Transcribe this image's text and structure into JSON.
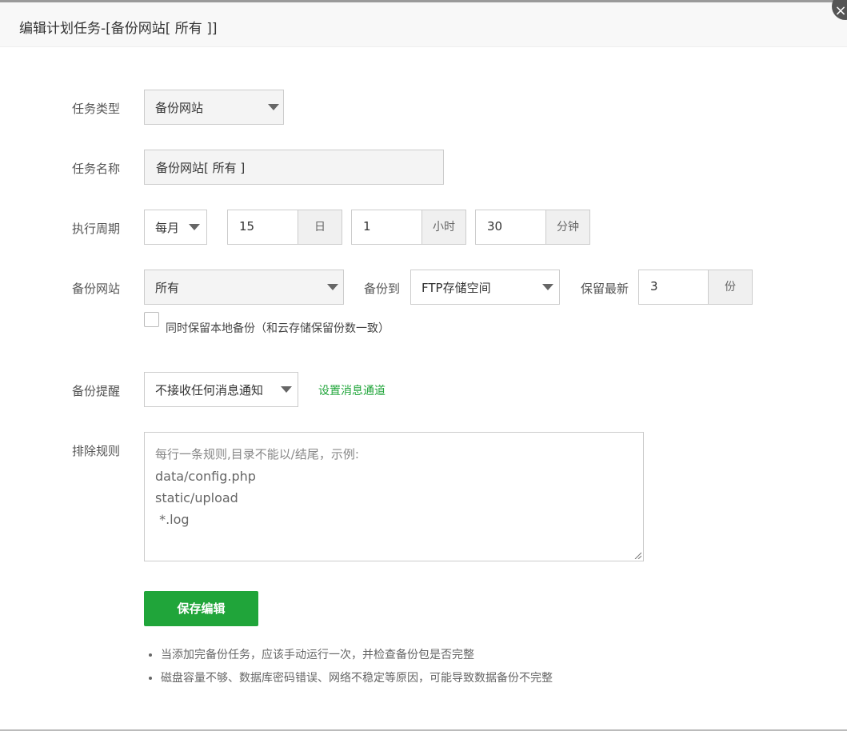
{
  "dialog": {
    "title": "编辑计划任务-[备份网站[ 所有 ]]",
    "close_glyph": "×"
  },
  "form": {
    "task_type": {
      "label": "任务类型",
      "value": "备份网站"
    },
    "task_name": {
      "label": "任务名称",
      "value": "备份网站[ 所有 ]"
    },
    "cycle": {
      "label": "执行周期",
      "period": "每月",
      "day": "15",
      "day_unit": "日",
      "hour": "1",
      "hour_unit": "小时",
      "minute": "30",
      "minute_unit": "分钟"
    },
    "backup_site": {
      "label": "备份网站",
      "value": "所有",
      "backup_to_label": "备份到",
      "backup_to": "FTP存储空间",
      "keep_label": "保留最新",
      "keep_value": "3",
      "keep_unit": "份",
      "local_checkbox_label": "同时保留本地备份（和云存储保留份数一致）",
      "local_checked": false
    },
    "reminder": {
      "label": "备份提醒",
      "value": "不接收任何消息通知",
      "link": "设置消息通道"
    },
    "exclude": {
      "label": "排除规则",
      "placeholder_lines": [
        "每行一条规则,目录不能以/结尾，示例:",
        "data/config.php",
        "static/upload",
        " *.log"
      ]
    },
    "save_label": "保存编辑"
  },
  "notes": [
    "当添加完备份任务，应该手动运行一次，并检查备份包是否完整",
    "磁盘容量不够、数据库密码错误、网络不稳定等原因，可能导致数据备份不完整"
  ],
  "colors": {
    "accent": "#20a53a",
    "close_bg": "#555555"
  }
}
